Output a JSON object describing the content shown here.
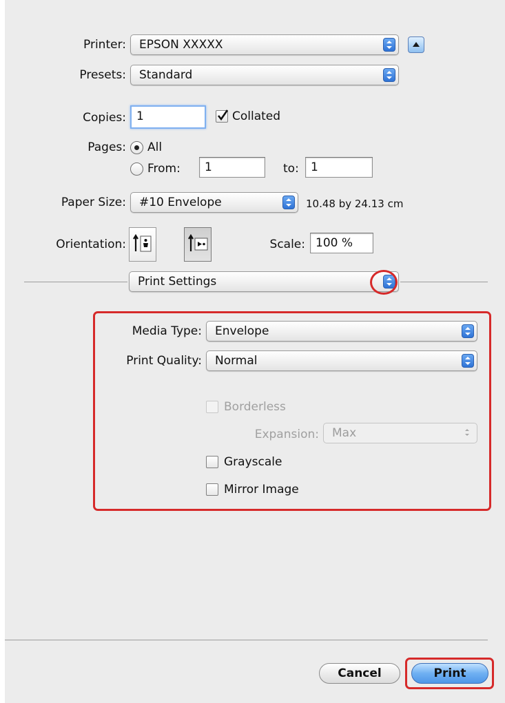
{
  "printer": {
    "label": "Printer:",
    "value": "EPSON XXXXX"
  },
  "presets": {
    "label": "Presets:",
    "value": "Standard"
  },
  "copies": {
    "label": "Copies:",
    "value": "1",
    "collated_label": "Collated",
    "collated": true
  },
  "pages": {
    "label": "Pages:",
    "all_label": "All",
    "from_label": "From:",
    "from_value": "1",
    "to_label": "to:",
    "to_value": "1",
    "selected": "All"
  },
  "paper_size": {
    "label": "Paper Size:",
    "value": "#10 Envelope",
    "dimensions": "10.48 by 24.13 cm"
  },
  "orientation": {
    "label": "Orientation:",
    "selected": "landscape"
  },
  "scale": {
    "label": "Scale:",
    "value": "100 %"
  },
  "panel_menu": {
    "value": "Print Settings"
  },
  "print_settings": {
    "media_type_label": "Media Type:",
    "media_type": "Envelope",
    "print_quality_label": "Print Quality:",
    "print_quality": "Normal",
    "borderless_label": "Borderless",
    "borderless_enabled": false,
    "expansion_label": "Expansion:",
    "expansion_value": "Max",
    "grayscale_label": "Grayscale",
    "grayscale": false,
    "mirror_label": "Mirror Image",
    "mirror": false
  },
  "buttons": {
    "cancel": "Cancel",
    "print": "Print"
  },
  "colors": {
    "highlight": "#d62a2a",
    "accent": "#2f73d6",
    "background": "#ececec"
  }
}
